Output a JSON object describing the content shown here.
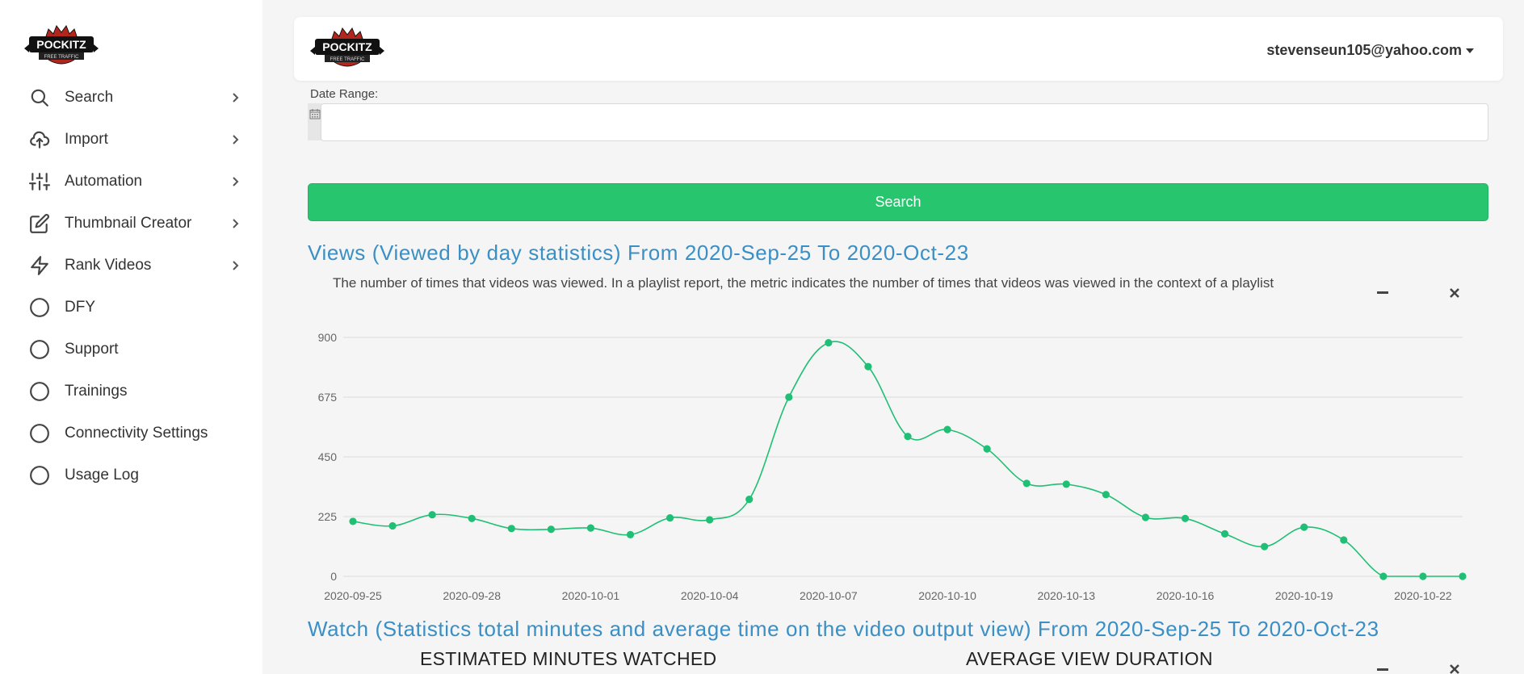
{
  "brand": {
    "logo_text": "POCKITZ",
    "logo_subtext": "FREE TRAFFIC"
  },
  "sidebar": {
    "items": [
      {
        "label": "Search",
        "icon": "search-icon",
        "has_children": true
      },
      {
        "label": "Import",
        "icon": "cloud-upload-icon",
        "has_children": true
      },
      {
        "label": "Automation",
        "icon": "sliders-icon",
        "has_children": true
      },
      {
        "label": "Thumbnail Creator",
        "icon": "edit-icon",
        "has_children": true
      },
      {
        "label": "Rank Videos",
        "icon": "lightning-icon",
        "has_children": true
      },
      {
        "label": "DFY",
        "icon": "circle-icon",
        "has_children": false
      },
      {
        "label": "Support",
        "icon": "circle-icon",
        "has_children": false
      },
      {
        "label": "Trainings",
        "icon": "circle-icon",
        "has_children": false
      },
      {
        "label": "Connectivity Settings",
        "icon": "circle-icon",
        "has_children": false
      },
      {
        "label": "Usage Log",
        "icon": "circle-icon",
        "has_children": false
      }
    ]
  },
  "header": {
    "user_email": "stevenseun105@yahoo.com"
  },
  "filters": {
    "date_range_label": "Date Range:",
    "date_range_value": ""
  },
  "search_button_label": "Search",
  "views_section": {
    "title": "Views (Viewed by day statistics) From 2020-Sep-25 To 2020-Oct-23",
    "description": "The number of times that videos was viewed. In a playlist report, the metric indicates the number of times that videos was viewed in the context of a playlist"
  },
  "watch_section": {
    "title": "Watch (Statistics total minutes and average time on the video output view) From 2020-Sep-25 To 2020-Oct-23",
    "left_heading": "ESTIMATED MINUTES WATCHED",
    "right_heading": "AVERAGE VIEW DURATION"
  },
  "colors": {
    "accent_green": "#27c56d",
    "line_green": "#1fbf75",
    "title_blue": "#3a8fc4"
  },
  "chart_data": {
    "type": "line",
    "title": "",
    "xlabel": "",
    "ylabel": "",
    "x": [
      "2020-09-25",
      "2020-09-26",
      "2020-09-27",
      "2020-09-28",
      "2020-09-29",
      "2020-09-30",
      "2020-10-01",
      "2020-10-02",
      "2020-10-03",
      "2020-10-04",
      "2020-10-05",
      "2020-10-06",
      "2020-10-07",
      "2020-10-08",
      "2020-10-09",
      "2020-10-10",
      "2020-10-11",
      "2020-10-12",
      "2020-10-13",
      "2020-10-14",
      "2020-10-15",
      "2020-10-16",
      "2020-10-17",
      "2020-10-18",
      "2020-10-19",
      "2020-10-20",
      "2020-10-21",
      "2020-10-22",
      "2020-10-23"
    ],
    "series": [
      {
        "values": [
          207,
          190,
          232,
          218,
          180,
          177,
          182,
          157,
          220,
          213,
          290,
          675,
          880,
          790,
          527,
          553,
          480,
          350,
          347,
          308,
          222,
          218,
          160,
          112,
          185,
          137,
          0,
          0,
          0
        ]
      }
    ],
    "x_tick_labels": [
      "2020-09-25",
      "2020-09-28",
      "2020-10-01",
      "2020-10-04",
      "2020-10-07",
      "2020-10-10",
      "2020-10-13",
      "2020-10-16",
      "2020-10-19",
      "2020-10-22"
    ],
    "y_ticks": [
      0,
      225,
      450,
      675,
      900
    ],
    "ylim": [
      0,
      900
    ],
    "grid": true,
    "legend": "none"
  }
}
